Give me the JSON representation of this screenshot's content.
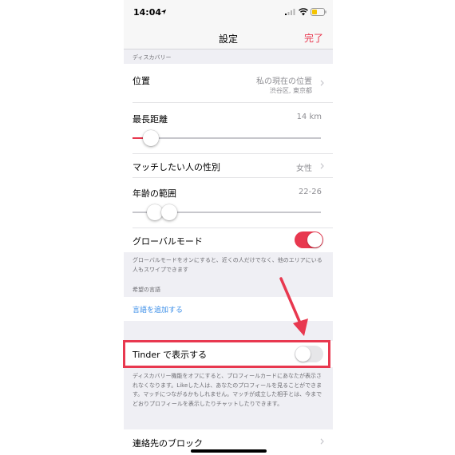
{
  "status": {
    "time": "14:04"
  },
  "nav": {
    "title": "設定",
    "done": "完了"
  },
  "discovery": {
    "section_label": "ディスカバリー",
    "location_label": "位置",
    "location_value": "私の現在の位置",
    "location_sub": "渋谷区, 東京都",
    "distance_label": "最長距離",
    "distance_value": "14 km",
    "distance_fraction": 0.06,
    "gender_label": "マッチしたい人の性別",
    "gender_value": "女性",
    "age_label": "年齢の範囲",
    "age_value": "22-26",
    "global_label": "グローバルモード",
    "global_on": true,
    "global_footer": "グローバルモードをオンにすると、近くの人だけでなく、他のエリアにいる人もスワイプできます"
  },
  "language": {
    "section_label": "希望の言語",
    "add_link": "言語を追加する"
  },
  "tinder": {
    "label": "Tinder で表示する",
    "on": false,
    "footer": "ディスカバリー機能をオフにすると、プロフィールカードにあなたが表示されなくなります。Likeした人は、あなたのプロフィールを見ることができます。マッチにつながるかもしれません。マッチが成立した相手とは、今までどおりプロフィールを表示したりチャットしたりできます。"
  },
  "blocking": {
    "label": "連絡先のブロック"
  },
  "colors": {
    "accent": "#e8384f",
    "link": "#3b8ee8",
    "background": "#efeff4"
  }
}
